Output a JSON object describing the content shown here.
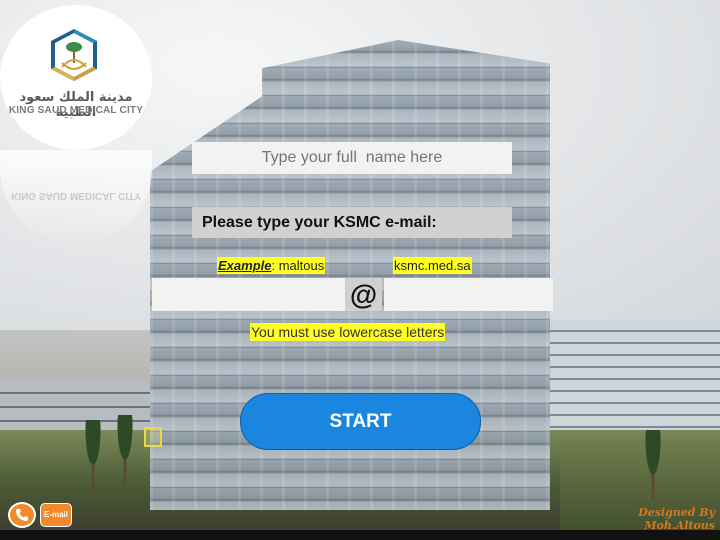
{
  "logo": {
    "arabic_name": "مدينة الملك سعود الطبية",
    "english_name": "KING SAUD MEDICAL CITY",
    "reflection_text": "KING SAUD MEDICAL CITY"
  },
  "form": {
    "name_placeholder": "Type your full  name here",
    "email_label": "Please type your KSMC e-mail:",
    "example_label": "Example",
    "example_user": ": maltous",
    "example_domain": "ksmc.med.sa",
    "at_symbol": "@",
    "lowercase_note": "You must use lowercase letters",
    "start_label": "START"
  },
  "footer": {
    "email_button": "E-mail",
    "credit": "Designed By Moh.Altous"
  },
  "colors": {
    "start_button": "#1a86e0",
    "highlight": "#ffff22",
    "footer_buttons": "#f08a2c",
    "credit_text": "#d4781c"
  },
  "icons": [
    "phone-icon",
    "logo-emblem-icon"
  ]
}
